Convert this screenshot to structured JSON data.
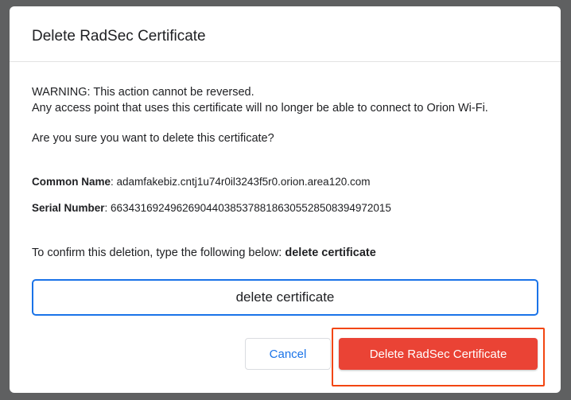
{
  "dialog": {
    "title": "Delete RadSec Certificate",
    "warning_line1": "WARNING: This action cannot be reversed.",
    "warning_line2": "Any access point that uses this certificate will no longer be able to connect to Orion Wi-Fi.",
    "question": "Are you sure you want to delete this certificate?",
    "common_name_label": "Common Name",
    "common_name_value": ": adamfakebiz.cntj1u74r0il3243f5r0.orion.area120.com",
    "serial_number_label": "Serial Number",
    "serial_number_value": ": 66343169249626904403853788186305528508394972015",
    "confirm_prompt": "To confirm this deletion, type the following below: ",
    "confirm_phrase": "delete certificate",
    "confirm_input_value": "delete certificate",
    "cancel_label": "Cancel",
    "delete_label": "Delete RadSec Certificate"
  },
  "colors": {
    "primary_blue": "#1a73e8",
    "danger_red": "#ea4335",
    "highlight_orange": "#f24611",
    "backdrop": "#5f6061"
  }
}
